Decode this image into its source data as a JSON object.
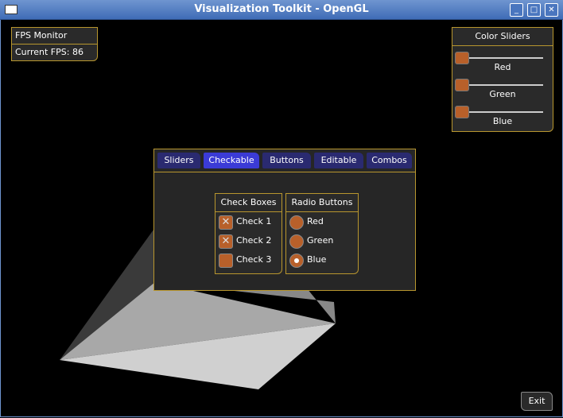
{
  "window": {
    "title": "Visualization Toolkit - OpenGL",
    "buttons": [
      "minimize",
      "maximize",
      "close"
    ]
  },
  "fps_monitor": {
    "title": "FPS Monitor",
    "current_fps": "Current FPS: 86"
  },
  "color_sliders": {
    "title": "Color Sliders",
    "sliders": [
      {
        "label": "Red",
        "value": 0
      },
      {
        "label": "Green",
        "value": 0
      },
      {
        "label": "Blue",
        "value": 0
      }
    ]
  },
  "tabs": [
    {
      "label": "Sliders",
      "active": false
    },
    {
      "label": "Checkable",
      "active": true
    },
    {
      "label": "Buttons",
      "active": false
    },
    {
      "label": "Editable",
      "active": false
    },
    {
      "label": "Combos",
      "active": false
    }
  ],
  "check_boxes": {
    "title": "Check Boxes",
    "items": [
      {
        "label": "Check 1",
        "checked": true
      },
      {
        "label": "Check 2",
        "checked": true
      },
      {
        "label": "Check 3",
        "checked": false
      }
    ]
  },
  "radio_buttons": {
    "title": "Radio Buttons",
    "items": [
      {
        "label": "Red",
        "selected": false
      },
      {
        "label": "Green",
        "selected": false
      },
      {
        "label": "Blue",
        "selected": true
      }
    ]
  },
  "exit_label": "Exit",
  "colors": {
    "panel_border": "#b8962e",
    "tab_active": "#3b3bd6",
    "tab_inactive": "#2a2a70",
    "knob": "#b8602a"
  }
}
